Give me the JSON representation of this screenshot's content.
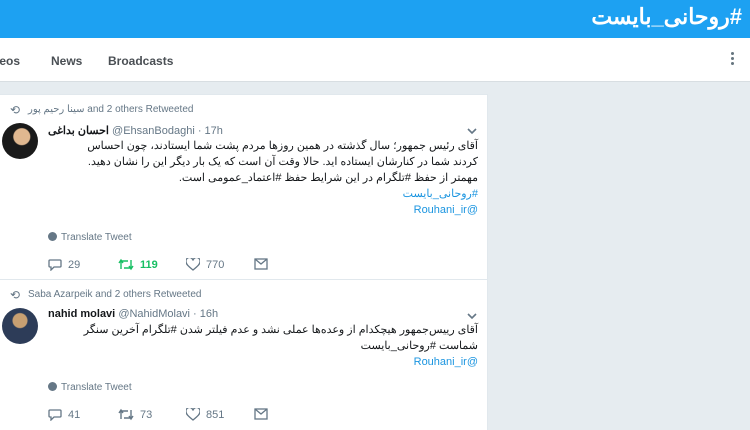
{
  "header": {
    "hashtag": "#روحانی_بایست"
  },
  "nav": {
    "tabs": [
      "deos",
      "News",
      "Broadcasts"
    ]
  },
  "tweets": [
    {
      "context": "سینا رحیم پور and 2 others Retweeted",
      "name": "احسان بداغی",
      "meta": "@EhsanBodaghi · 17h",
      "lines": [
        "آقای رئیس جمهور؛ سال گذشته در همین روزها مردم پشت شما ایستادند، چون احساس",
        "کردند شما در کنارشان ایستاده اید. حالا وقت آن است که یک بار دیگر این را نشان دهید.",
        "مهمتر از حفظ #تلگرام در این شرایط حفظ #اعتماد_عمومی است.",
        "#روحانی_بایست",
        "@Rouhani_ir"
      ],
      "translate": "Translate Tweet",
      "replies": "29",
      "retweets": "119",
      "likes": "770"
    },
    {
      "context": "Saba Azarpeik and 2 others Retweeted",
      "name": "nahid molavi",
      "meta": "@NahidMolavi · 16h",
      "lines": [
        "آقای رییس‌جمهور هیچکدام از وعده‌ها عملی نشد و عدم فیلتر شدن #تلگرام آخرین سنگر",
        "شماست #روحانی_بایست",
        "@Rouhani_ir"
      ],
      "translate": "Translate Tweet",
      "replies": "41",
      "retweets": "73",
      "likes": "851"
    }
  ]
}
